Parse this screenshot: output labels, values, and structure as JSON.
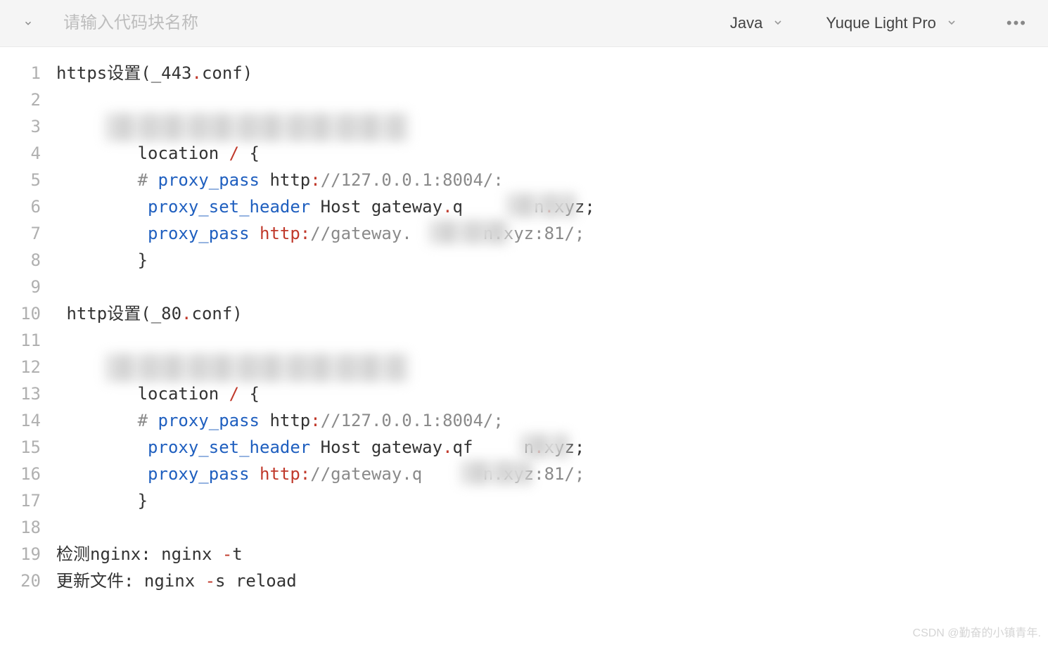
{
  "toolbar": {
    "name_placeholder": "请输入代码块名称",
    "language": "Java",
    "theme": "Yuque Light Pro"
  },
  "lines": [
    {
      "n": "1",
      "segs": [
        {
          "c": "tk-txt",
          "t": "https设置"
        },
        {
          "c": "tk-txt",
          "t": "(_443"
        },
        {
          "c": "tk-punc",
          "t": "."
        },
        {
          "c": "tk-txt",
          "t": "conf)"
        }
      ]
    },
    {
      "n": "2",
      "segs": []
    },
    {
      "n": "3",
      "blur": "b1",
      "segs": []
    },
    {
      "n": "4",
      "segs": [
        {
          "c": "tk-txt",
          "t": "        location "
        },
        {
          "c": "tk-punc",
          "t": "/"
        },
        {
          "c": "tk-txt",
          "t": " {"
        }
      ]
    },
    {
      "n": "5",
      "segs": [
        {
          "c": "tk-txt",
          "t": "        "
        },
        {
          "c": "tk-cmt",
          "t": "# "
        },
        {
          "c": "tk-kw",
          "t": "proxy_pass"
        },
        {
          "c": "tk-txt",
          "t": " http"
        },
        {
          "c": "tk-punc",
          "t": ":"
        },
        {
          "c": "tk-cmt",
          "t": "//127.0.0.1:8004/:"
        }
      ]
    },
    {
      "n": "6",
      "blur": "b2",
      "segs": [
        {
          "c": "tk-txt",
          "t": "         "
        },
        {
          "c": "tk-kw",
          "t": "proxy_set_header"
        },
        {
          "c": "tk-txt",
          "t": " Host gateway"
        },
        {
          "c": "tk-punc",
          "t": "."
        },
        {
          "c": "tk-txt",
          "t": "q       n"
        },
        {
          "c": "tk-punc",
          "t": "."
        },
        {
          "c": "tk-txt",
          "t": "xyz;"
        }
      ]
    },
    {
      "n": "7",
      "blur": "b3",
      "segs": [
        {
          "c": "tk-txt",
          "t": "         "
        },
        {
          "c": "tk-kw",
          "t": "proxy_pass"
        },
        {
          "c": "tk-txt",
          "t": " "
        },
        {
          "c": "tk-str",
          "t": "http"
        },
        {
          "c": "tk-punc",
          "t": ":"
        },
        {
          "c": "tk-cmt",
          "t": "//gateway.       n.xyz:81/;"
        }
      ]
    },
    {
      "n": "8",
      "segs": [
        {
          "c": "tk-txt",
          "t": "        }"
        }
      ]
    },
    {
      "n": "9",
      "segs": []
    },
    {
      "n": "10",
      "segs": [
        {
          "c": "tk-txt",
          "t": " http设置"
        },
        {
          "c": "tk-txt",
          "t": "(_80"
        },
        {
          "c": "tk-punc",
          "t": "."
        },
        {
          "c": "tk-txt",
          "t": "conf)"
        }
      ]
    },
    {
      "n": "11",
      "segs": []
    },
    {
      "n": "12",
      "blur": "b4",
      "segs": []
    },
    {
      "n": "13",
      "segs": [
        {
          "c": "tk-txt",
          "t": "        location "
        },
        {
          "c": "tk-punc",
          "t": "/"
        },
        {
          "c": "tk-txt",
          "t": " {"
        }
      ]
    },
    {
      "n": "14",
      "segs": [
        {
          "c": "tk-txt",
          "t": "        "
        },
        {
          "c": "tk-cmt",
          "t": "# "
        },
        {
          "c": "tk-kw",
          "t": "proxy_pass"
        },
        {
          "c": "tk-txt",
          "t": " http"
        },
        {
          "c": "tk-punc",
          "t": ":"
        },
        {
          "c": "tk-cmt",
          "t": "//127.0.0.1:8004/;"
        }
      ]
    },
    {
      "n": "15",
      "blur": "b5",
      "segs": [
        {
          "c": "tk-txt",
          "t": "         "
        },
        {
          "c": "tk-kw",
          "t": "proxy_set_header"
        },
        {
          "c": "tk-txt",
          "t": " Host gateway"
        },
        {
          "c": "tk-punc",
          "t": "."
        },
        {
          "c": "tk-txt",
          "t": "qf     n"
        },
        {
          "c": "tk-punc",
          "t": "."
        },
        {
          "c": "tk-txt",
          "t": "xyz;"
        }
      ]
    },
    {
      "n": "16",
      "blur": "b6",
      "segs": [
        {
          "c": "tk-txt",
          "t": "         "
        },
        {
          "c": "tk-kw",
          "t": "proxy_pass"
        },
        {
          "c": "tk-txt",
          "t": " "
        },
        {
          "c": "tk-str",
          "t": "http"
        },
        {
          "c": "tk-punc",
          "t": ":"
        },
        {
          "c": "tk-cmt",
          "t": "//gateway.q      n.xyz:81/;"
        }
      ]
    },
    {
      "n": "17",
      "segs": [
        {
          "c": "tk-txt",
          "t": "        }"
        }
      ]
    },
    {
      "n": "18",
      "segs": []
    },
    {
      "n": "19",
      "segs": [
        {
          "c": "tk-txt",
          "t": "检测nginx: nginx "
        },
        {
          "c": "tk-punc",
          "t": "-"
        },
        {
          "c": "tk-txt",
          "t": "t"
        }
      ]
    },
    {
      "n": "20",
      "segs": [
        {
          "c": "tk-txt",
          "t": "更新文件: nginx "
        },
        {
          "c": "tk-punc",
          "t": "-"
        },
        {
          "c": "tk-txt",
          "t": "s reload"
        }
      ]
    }
  ],
  "watermark": "CSDN @勤奋的小镇青年."
}
